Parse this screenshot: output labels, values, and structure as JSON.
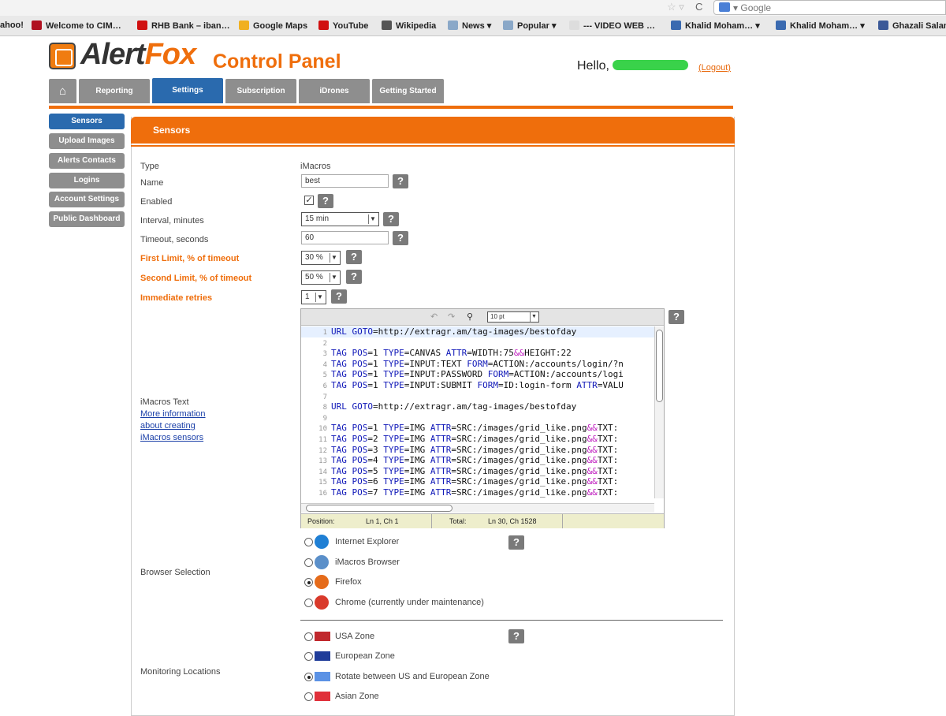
{
  "browser": {
    "search_placeholder": "Google",
    "bookmarks": [
      {
        "label": "ahoo!",
        "color": "#7b0099"
      },
      {
        "label": "Welcome to CIM…",
        "color": "#b01020"
      },
      {
        "label": "RHB Bank – iban…",
        "color": "#d01010"
      },
      {
        "label": "Google Maps",
        "color": "#f0b020"
      },
      {
        "label": "YouTube",
        "color": "#d01010"
      },
      {
        "label": "Wikipedia",
        "color": "#555555"
      },
      {
        "label": "News ▾",
        "color": "#8aa8c8"
      },
      {
        "label": "Popular ▾",
        "color": "#8aa8c8"
      },
      {
        "label": "--- VIDEO WEB …",
        "color": "#dddddd"
      },
      {
        "label": "Khalid Moham… ▾",
        "color": "#3a6ab0"
      },
      {
        "label": "Khalid Moham… ▾",
        "color": "#3a6ab0"
      },
      {
        "label": "Ghazali Salan",
        "color": "#3b5998"
      }
    ]
  },
  "header": {
    "logo_alert": "Alert",
    "logo_fox": "Fox",
    "title": "Control Panel",
    "hello": "Hello,",
    "logout": "(Logout)"
  },
  "tabs": [
    "Reporting",
    "Settings",
    "Subscription",
    "iDrones",
    "Getting Started"
  ],
  "active_tab": "Settings",
  "sidebar": [
    "Sensors",
    "Upload Images",
    "Alerts Contacts",
    "Logins",
    "Account Settings",
    "Public Dashboard"
  ],
  "panel_title": "Sensors",
  "form": {
    "type_label": "Type",
    "type_value": "iMacros",
    "name_label": "Name",
    "name_value": "best",
    "enabled_label": "Enabled",
    "interval_label": "Interval, minutes",
    "interval_value": "15 min",
    "timeout_label": "Timeout, seconds",
    "timeout_value": "60",
    "first_limit_label": "First Limit, % of timeout",
    "first_limit_value": "30 %",
    "second_limit_label": "Second Limit, % of timeout",
    "second_limit_value": "50 %",
    "retries_label": "Immediate retries",
    "retries_value": "1",
    "help": "?",
    "imacros_text_label": "iMacros Text",
    "more_info_1": "More information",
    "more_info_2": "about creating",
    "more_info_3": "iMacros sensors",
    "browser_label": "Browser Selection",
    "monitoring_label": "Monitoring Locations"
  },
  "editor": {
    "font_size": "10 pt",
    "position_label": "Position:",
    "position_value": "Ln 1, Ch 1",
    "total_label": "Total:",
    "total_value": "Ln 30, Ch 1528",
    "lines": [
      {
        "n": "1",
        "text": "URL GOTO=http://extragr.am/tag-images/bestofday"
      },
      {
        "n": "2",
        "text": ""
      },
      {
        "n": "3",
        "text": "TAG POS=1 TYPE=CANVAS ATTR=WIDTH:75&&HEIGHT:22"
      },
      {
        "n": "4",
        "text": "TAG POS=1 TYPE=INPUT:TEXT FORM=ACTION:/accounts/login/?n"
      },
      {
        "n": "5",
        "text": "TAG POS=1 TYPE=INPUT:PASSWORD FORM=ACTION:/accounts/logi"
      },
      {
        "n": "6",
        "text": "TAG POS=1 TYPE=INPUT:SUBMIT FORM=ID:login-form ATTR=VALU"
      },
      {
        "n": "7",
        "text": ""
      },
      {
        "n": "8",
        "text": "URL GOTO=http://extragr.am/tag-images/bestofday"
      },
      {
        "n": "9",
        "text": ""
      },
      {
        "n": "10",
        "text": "TAG POS=1 TYPE=IMG ATTR=SRC:/images/grid_like.png&&TXT:"
      },
      {
        "n": "11",
        "text": "TAG POS=2 TYPE=IMG ATTR=SRC:/images/grid_like.png&&TXT:"
      },
      {
        "n": "12",
        "text": "TAG POS=3 TYPE=IMG ATTR=SRC:/images/grid_like.png&&TXT:"
      },
      {
        "n": "13",
        "text": "TAG POS=4 TYPE=IMG ATTR=SRC:/images/grid_like.png&&TXT:"
      },
      {
        "n": "14",
        "text": "TAG POS=5 TYPE=IMG ATTR=SRC:/images/grid_like.png&&TXT:"
      },
      {
        "n": "15",
        "text": "TAG POS=6 TYPE=IMG ATTR=SRC:/images/grid_like.png&&TXT:"
      },
      {
        "n": "16",
        "text": "TAG POS=7 TYPE=IMG ATTR=SRC:/images/grid_like.png&&TXT:"
      }
    ]
  },
  "browsers": [
    {
      "label": "Internet Explorer",
      "selected": false,
      "icon": "ie-icon",
      "color": "#1f7fd4"
    },
    {
      "label": "iMacros Browser",
      "selected": false,
      "icon": "imacros-icon",
      "color": "#5a8fc9"
    },
    {
      "label": "Firefox",
      "selected": true,
      "icon": "firefox-icon",
      "color": "#e56b1a"
    },
    {
      "label": "Chrome (currently under maintenance)",
      "selected": false,
      "icon": "chrome-icon",
      "color": "#d93a2b"
    }
  ],
  "zones": [
    {
      "label": "USA Zone",
      "selected": false,
      "icon": "usa-flag-icon",
      "color": "#c0282d"
    },
    {
      "label": "European Zone",
      "selected": false,
      "icon": "eu-flag-icon",
      "color": "#1f3c99"
    },
    {
      "label": "Rotate between US and European Zone",
      "selected": true,
      "icon": "un-flag-icon",
      "color": "#5b92e5"
    },
    {
      "label": "Asian Zone",
      "selected": false,
      "icon": "asia-flag-icon",
      "color": "#e0303a"
    }
  ]
}
